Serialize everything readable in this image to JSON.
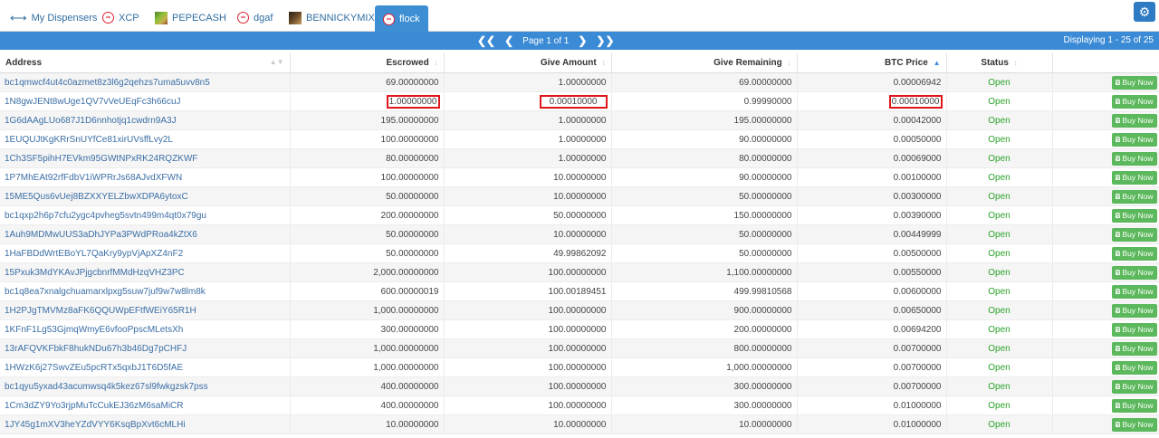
{
  "tabs": [
    {
      "label": "My Dispensers",
      "icon": "arrows-icon"
    },
    {
      "label": "XCP",
      "icon": "xcp-icon"
    },
    {
      "label": "PEPECASH",
      "icon": "pepecash-icon"
    },
    {
      "label": "dgaf",
      "icon": "xcp-icon"
    },
    {
      "label": "BENNICKYMIX",
      "icon": "bennickymix-icon"
    },
    {
      "label": "flock",
      "icon": "xcp-icon"
    }
  ],
  "pager": {
    "page_text": "Page 1 of 1",
    "displaying": "Displaying 1 - 25 of 25"
  },
  "columns": [
    "Address",
    "Escrowed",
    "Give Amount",
    "Give Remaining",
    "BTC Price",
    "Status"
  ],
  "buy_label": "Buy Now",
  "rows": [
    [
      "bc1qmwcf4ut4c0azmet8z3l6g2qehzs7uma5uvv8n5",
      "69.00000000",
      "1.00000000",
      "69.00000000",
      "0.00006942",
      "Open"
    ],
    [
      "1N8gwJENt8wUge1QV7vVeUEqFc3h66cuJ",
      "1.00000000",
      "0.00010000",
      "0.99990000",
      "0.00010000",
      "Open"
    ],
    [
      "1G6dAAgLUo687J1D6nnhotjq1cwdrn9A3J",
      "195.00000000",
      "1.00000000",
      "195.00000000",
      "0.00042000",
      "Open"
    ],
    [
      "1EUQUJtKgKRrSnUYfCe81xirUVsffLvy2L",
      "100.00000000",
      "1.00000000",
      "90.00000000",
      "0.00050000",
      "Open"
    ],
    [
      "1Ch3SF5pihH7EVkm95GWtNPxRK24RQZKWF",
      "80.00000000",
      "1.00000000",
      "80.00000000",
      "0.00069000",
      "Open"
    ],
    [
      "1P7MhEAt92rfFdbV1iWPRrJs68AJvdXFWN",
      "100.00000000",
      "10.00000000",
      "90.00000000",
      "0.00100000",
      "Open"
    ],
    [
      "15ME5Qus6vUej8BZXXYELZbwXDPA6ytoxC",
      "50.00000000",
      "10.00000000",
      "50.00000000",
      "0.00300000",
      "Open"
    ],
    [
      "bc1qxp2h6p7cfu2ygc4pvheg5svtn499m4qt0x79gu",
      "200.00000000",
      "50.00000000",
      "150.00000000",
      "0.00390000",
      "Open"
    ],
    [
      "1Auh9MDMwUUS3aDhJYPa3PWdPRoa4kZtX6",
      "50.00000000",
      "10.00000000",
      "50.00000000",
      "0.00449999",
      "Open"
    ],
    [
      "1HaFBDdWrtEBoYL7QaKry9ypVjApXZ4nF2",
      "50.00000000",
      "49.99862092",
      "50.00000000",
      "0.00500000",
      "Open"
    ],
    [
      "15Pxuk3MdYKAvJPjgcbnrfMMdHzqVHZ3PC",
      "2,000.00000000",
      "100.00000000",
      "1,100.00000000",
      "0.00550000",
      "Open"
    ],
    [
      "bc1q8ea7xnalgchuamarxlpxg5suw7juf9w7w8lm8k",
      "600.00000019",
      "100.00189451",
      "499.99810568",
      "0.00600000",
      "Open"
    ],
    [
      "1H2PJgTMVMz8aFK6QQUWpEFtfWEiY65R1H",
      "1,000.00000000",
      "100.00000000",
      "900.00000000",
      "0.00650000",
      "Open"
    ],
    [
      "1KFnF1Lg53GjmqWmyE6vfooPpscMLetsXh",
      "300.00000000",
      "100.00000000",
      "200.00000000",
      "0.00694200",
      "Open"
    ],
    [
      "13rAFQVKFbkF8hukNDu67h3b46Dg7pCHFJ",
      "1,000.00000000",
      "100.00000000",
      "800.00000000",
      "0.00700000",
      "Open"
    ],
    [
      "1HWzK6j27SwvZEu5pcRTx5qxbJ1T6D5fAE",
      "1,000.00000000",
      "100.00000000",
      "1,000.00000000",
      "0.00700000",
      "Open"
    ],
    [
      "bc1qyu5yxad43acumwsq4k5kez67sl9fwkgzsk7pss",
      "400.00000000",
      "100.00000000",
      "300.00000000",
      "0.00700000",
      "Open"
    ],
    [
      "1Cm3dZY9Yo3rjpMuTcCukEJ36zM6saMiCR",
      "400.00000000",
      "100.00000000",
      "300.00000000",
      "0.01000000",
      "Open"
    ],
    [
      "1JY45g1mXV3heYZdVYY6KsqBpXvt6cMLHi",
      "10.00000000",
      "10.00000000",
      "10.00000000",
      "0.01000000",
      "Open"
    ]
  ]
}
